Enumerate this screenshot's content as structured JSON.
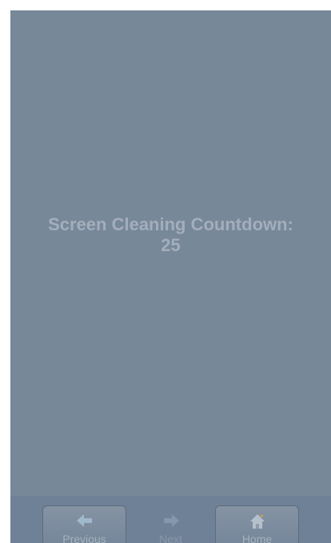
{
  "countdown": {
    "label": "Screen Cleaning Countdown:",
    "value": "25"
  },
  "navbar": {
    "previous_label": "Previous",
    "next_label": "Next",
    "home_label": "Home",
    "icons": {
      "previous": "arrow-left-icon",
      "next": "arrow-right-icon",
      "home": "home-icon"
    }
  },
  "colors": {
    "background": "#778899",
    "text": "#a4aebb",
    "navbar": "#6f8196"
  }
}
